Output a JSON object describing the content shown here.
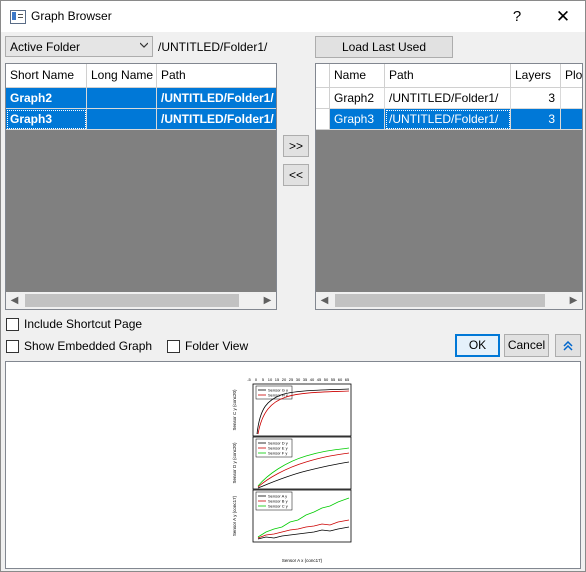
{
  "window": {
    "title": "Graph Browser",
    "help_glyph": "?",
    "close_glyph": "✕"
  },
  "toolbar": {
    "folder_select": "Active Folder",
    "folder_path": "/UNTITLED/Folder1/",
    "load_last_used": "Load Last Used"
  },
  "left_table": {
    "columns": [
      "Short Name",
      "Long Name",
      "Path"
    ],
    "rows": [
      {
        "short": "Graph2",
        "long": "",
        "path": "/UNTITLED/Folder1/"
      },
      {
        "short": "Graph3",
        "long": "",
        "path": "/UNTITLED/Folder1/"
      }
    ]
  },
  "right_table": {
    "columns": [
      "Name",
      "Path",
      "Layers",
      "Plo"
    ],
    "rows": [
      {
        "name": "Graph2",
        "path": "/UNTITLED/Folder1/",
        "layers": "3"
      },
      {
        "name": "Graph3",
        "path": "/UNTITLED/Folder1/",
        "layers": "3"
      }
    ]
  },
  "move": {
    "add": ">>",
    "remove": "<<"
  },
  "options": {
    "include_shortcut": "Include Shortcut Page",
    "show_embedded": "Show Embedded Graph",
    "folder_view": "Folder View"
  },
  "buttons": {
    "ok": "OK",
    "cancel": "Cancel"
  },
  "preview": {
    "top_ticks": [
      "-5",
      "0",
      "5",
      "10",
      "15",
      "20",
      "25",
      "30",
      "35",
      "40",
      "45",
      "50",
      "55",
      "60",
      "65"
    ],
    "x_axis_label": "Sensor A x (conc17)",
    "panels": [
      {
        "ylabel": "Sensor C y (conc20)",
        "legend": [
          "Sensor G y",
          "Sensor H y"
        ]
      },
      {
        "ylabel": "Sensor D y (conc20)",
        "legend": [
          "Sensor D y",
          "Sensor E y",
          "Sensor F y"
        ]
      },
      {
        "ylabel": "Sensor A y (conc17)",
        "legend": [
          "Sensor A y",
          "Sensor B y",
          "Sensor C y"
        ]
      }
    ]
  },
  "colors": {
    "selection": "#0078d7",
    "grid_bg": "#808080",
    "line_black": "#000000",
    "line_red": "#cc0000",
    "line_green": "#00cc00"
  }
}
